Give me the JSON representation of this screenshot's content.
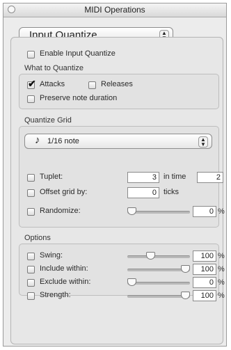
{
  "window": {
    "title": "MIDI Operations"
  },
  "mode_popup": {
    "label": "Input Quantize"
  },
  "enable": {
    "label": "Enable Input Quantize",
    "checked": false
  },
  "what_to_quantize": {
    "heading": "What to Quantize",
    "attacks": {
      "label": "Attacks",
      "checked": true
    },
    "releases": {
      "label": "Releases",
      "checked": false
    },
    "preserve": {
      "label": "Preserve note duration",
      "checked": false
    }
  },
  "quantize_grid": {
    "heading": "Quantize Grid",
    "grid_popup": {
      "icon": "eighth-note-icon",
      "glyph": "♪",
      "label": "1/16 note"
    },
    "tuplet": {
      "label": "Tuplet:",
      "value": "3",
      "in_time_label": "in time",
      "in_time_value": "2",
      "checked": false
    },
    "offset": {
      "label": "Offset grid by:",
      "value": "0",
      "unit": "ticks",
      "checked": false
    },
    "randomize": {
      "label": "Randomize:",
      "value": "0",
      "unit": "%",
      "slider_level": 0.0,
      "checked": false
    }
  },
  "options": {
    "heading": "Options",
    "swing": {
      "label": "Swing:",
      "value": "100",
      "unit": "%",
      "slider_level": 0.35,
      "checked": false
    },
    "include": {
      "label": "Include within:",
      "value": "100",
      "unit": "%",
      "slider_level": 1.0,
      "checked": false
    },
    "exclude": {
      "label": "Exclude within:",
      "value": "0",
      "unit": "%",
      "slider_level": 0.0,
      "checked": false
    },
    "strength": {
      "label": "Strength:",
      "value": "100",
      "unit": "%",
      "slider_level": 1.0,
      "checked": false
    }
  }
}
